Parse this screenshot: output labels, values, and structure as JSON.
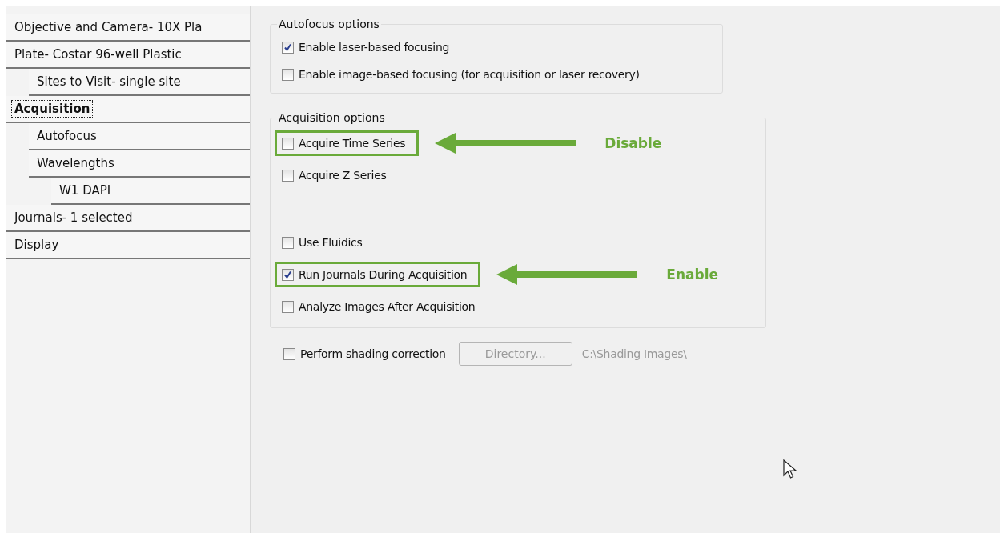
{
  "tree": [
    {
      "label": "Objective and Camera- 10X Pla",
      "selected": false
    },
    {
      "label": "Plate- Costar 96-well Plastic",
      "selected": false,
      "children": [
        {
          "label": "Sites to Visit- single site",
          "selected": false
        }
      ]
    },
    {
      "label": "Acquisition",
      "selected": true,
      "children": [
        {
          "label": "Autofocus",
          "selected": false
        },
        {
          "label": "Wavelengths",
          "selected": false,
          "children": [
            {
              "label": "W1 DAPI",
              "selected": false
            }
          ]
        }
      ]
    },
    {
      "label": "Journals- 1 selected",
      "selected": false
    },
    {
      "label": "Display",
      "selected": false
    }
  ],
  "groups": [
    {
      "title": "Autofocus options",
      "options": [
        {
          "label": "Enable laser-based focusing",
          "checked": true
        },
        {
          "label": "Enable image-based focusing (for acquisition or laser recovery)",
          "checked": false
        }
      ]
    },
    {
      "title": "Acquisition options",
      "options": [
        {
          "label": "Acquire Time Series",
          "checked": false,
          "callout": "Disable"
        },
        {
          "label": "Acquire Z Series",
          "checked": false,
          "gap_after": true
        },
        {
          "label": "Use Fluidics",
          "checked": false
        },
        {
          "label": "Run Journals During Acquisition",
          "checked": true,
          "callout": "Enable"
        },
        {
          "label": "Analyze Images After Acquisition",
          "checked": false
        }
      ]
    }
  ],
  "shading": {
    "label": "Perform shading correction",
    "checked": false,
    "button": "Directory...",
    "path": "C:\\Shading Images\\"
  }
}
